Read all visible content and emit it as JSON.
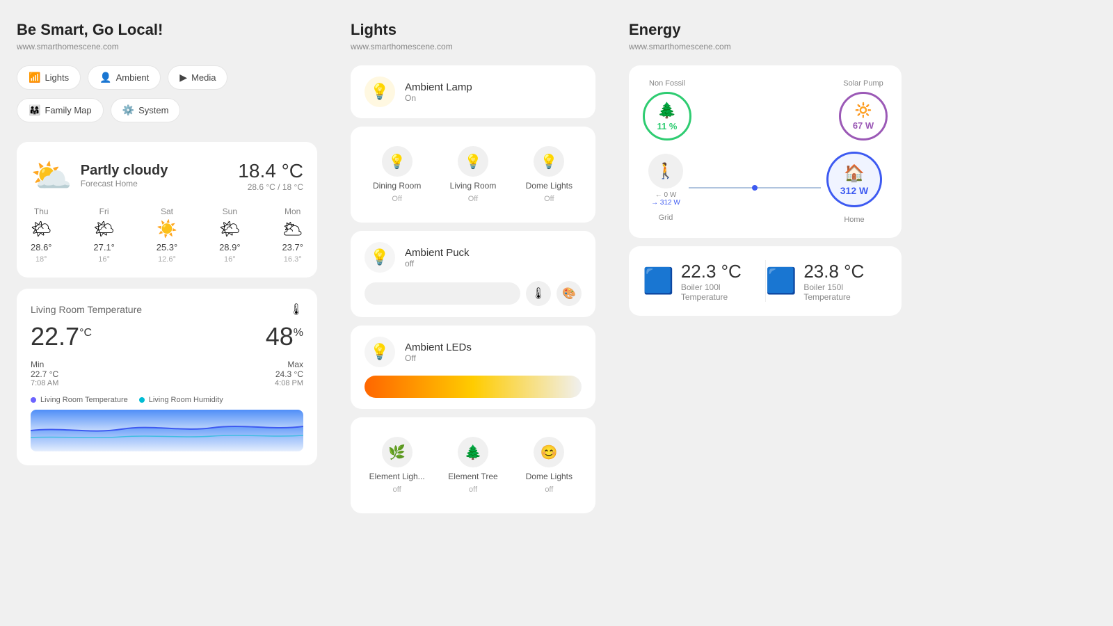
{
  "left": {
    "title": "Be Smart, Go Local!",
    "url": "www.smarthomescene.com",
    "nav": [
      {
        "id": "lights",
        "label": "Lights",
        "icon": "📶"
      },
      {
        "id": "ambient",
        "label": "Ambient",
        "icon": "👤"
      },
      {
        "id": "media",
        "label": "Media",
        "icon": "▶"
      },
      {
        "id": "family-map",
        "label": "Family Map",
        "icon": "👨‍👩‍👧"
      },
      {
        "id": "system",
        "label": "System",
        "icon": "⚙️"
      }
    ],
    "weather": {
      "condition": "Partly cloudy",
      "location": "Forecast Home",
      "temp": "18.4 °C",
      "range": "28.6 °C / 18 °C",
      "forecast": [
        {
          "day": "Thu",
          "icon": "🌤",
          "high": "28.6°",
          "low": "18°"
        },
        {
          "day": "Fri",
          "icon": "🌤",
          "high": "27.1°",
          "low": "16°"
        },
        {
          "day": "Sat",
          "icon": "☀️",
          "high": "25.3°",
          "low": "12.6°"
        },
        {
          "day": "Sun",
          "icon": "🌤",
          "high": "28.9°",
          "low": "16°"
        },
        {
          "day": "Mon",
          "icon": "🌥",
          "high": "23.7°",
          "low": "16.3°"
        }
      ]
    },
    "living_room": {
      "title": "Living Room Temperature",
      "temp": "22.7",
      "temp_unit": "°C",
      "humidity": "48",
      "humidity_unit": "%",
      "min_label": "Min",
      "min_temp": "22.7 °C",
      "min_time": "7:08 AM",
      "max_label": "Max",
      "max_temp": "24.3 °C",
      "max_time": "4:08 PM",
      "legend_temp": "Living Room Temperature",
      "legend_humidity": "Living Room Humidity"
    }
  },
  "middle": {
    "title": "Lights",
    "url": "www.smarthomescene.com",
    "lights": [
      {
        "id": "ambient-lamp",
        "name": "Ambient Lamp",
        "status": "On",
        "icon": "💡",
        "on": true
      }
    ],
    "light_grid_1": [
      {
        "id": "dining-room",
        "name": "Dining Room",
        "status": "Off",
        "icon": "💡"
      },
      {
        "id": "living-room",
        "name": "Living Room",
        "status": "Off",
        "icon": "💡"
      },
      {
        "id": "dome-lights-1",
        "name": "Dome Lights",
        "status": "Off",
        "icon": "💡"
      }
    ],
    "ambient_puck": {
      "name": "Ambient Puck",
      "status": "off",
      "icon": "💡"
    },
    "ambient_leds": {
      "name": "Ambient LEDs",
      "status": "Off",
      "icon": "💡"
    },
    "light_grid_2": [
      {
        "id": "element-light",
        "name": "Element Ligh...",
        "status": "off",
        "icon": "🌿"
      },
      {
        "id": "element-tree",
        "name": "Element Tree",
        "status": "off",
        "icon": "🌲"
      },
      {
        "id": "dome-lights-2",
        "name": "Dome Lights",
        "status": "off",
        "icon": "😊"
      }
    ]
  },
  "right": {
    "title": "Energy",
    "url": "www.smarthomescene.com",
    "energy": {
      "non_fossil_label": "Non Fossil",
      "non_fossil_pct": "11 %",
      "solar_label": "Solar Pump",
      "solar_w": "67 W",
      "grid_label": "Grid",
      "grid_in": "← 0 W",
      "grid_out": "→ 312 W",
      "home_label": "Home",
      "home_w": "312 W"
    },
    "boilers": [
      {
        "label": "Boiler 100l Temperature",
        "temp": "22.3 °C"
      },
      {
        "label": "Boiler 150l Temperature",
        "temp": "23.8 °C"
      }
    ]
  }
}
